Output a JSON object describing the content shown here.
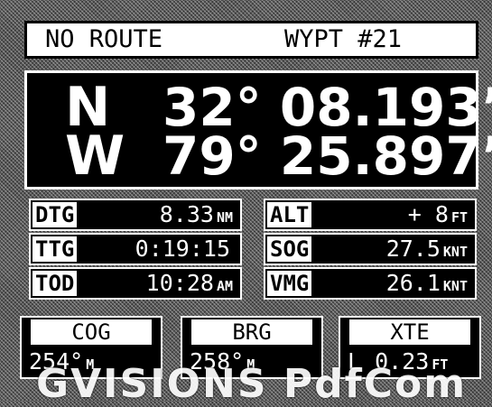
{
  "header": {
    "route_status": "NO ROUTE",
    "waypoint": "WYPT #21"
  },
  "position": {
    "lat_hemisphere": "N",
    "lat_value": "32° 08.193’",
    "lon_hemisphere": "W",
    "lon_value": "79° 25.897’"
  },
  "left_readouts": [
    {
      "tag": "DTG",
      "value": "8.33",
      "unit": "NM"
    },
    {
      "tag": "TTG",
      "value": "0:19:15",
      "unit": ""
    },
    {
      "tag": "TOD",
      "value": "10:28",
      "unit": "AM"
    }
  ],
  "right_readouts": [
    {
      "tag": "ALT",
      "value": "+ 8",
      "unit": "FT"
    },
    {
      "tag": "SOG",
      "value": "27.5",
      "unit": "KNT"
    },
    {
      "tag": "VMG",
      "value": "26.1",
      "unit": "KNT"
    }
  ],
  "course": [
    {
      "tag": "COG",
      "value": "254°",
      "unit": "M"
    },
    {
      "tag": "BRG",
      "value": "258°",
      "unit": "M"
    },
    {
      "tag": "XTE",
      "value": "L 0.23",
      "unit": "FT"
    }
  ],
  "watermark": "GVISIONS PdfCom",
  "colors": {
    "screen_bg": "#000000",
    "text": "#ffffff",
    "label_bg": "#ffffff",
    "label_text": "#000000"
  }
}
